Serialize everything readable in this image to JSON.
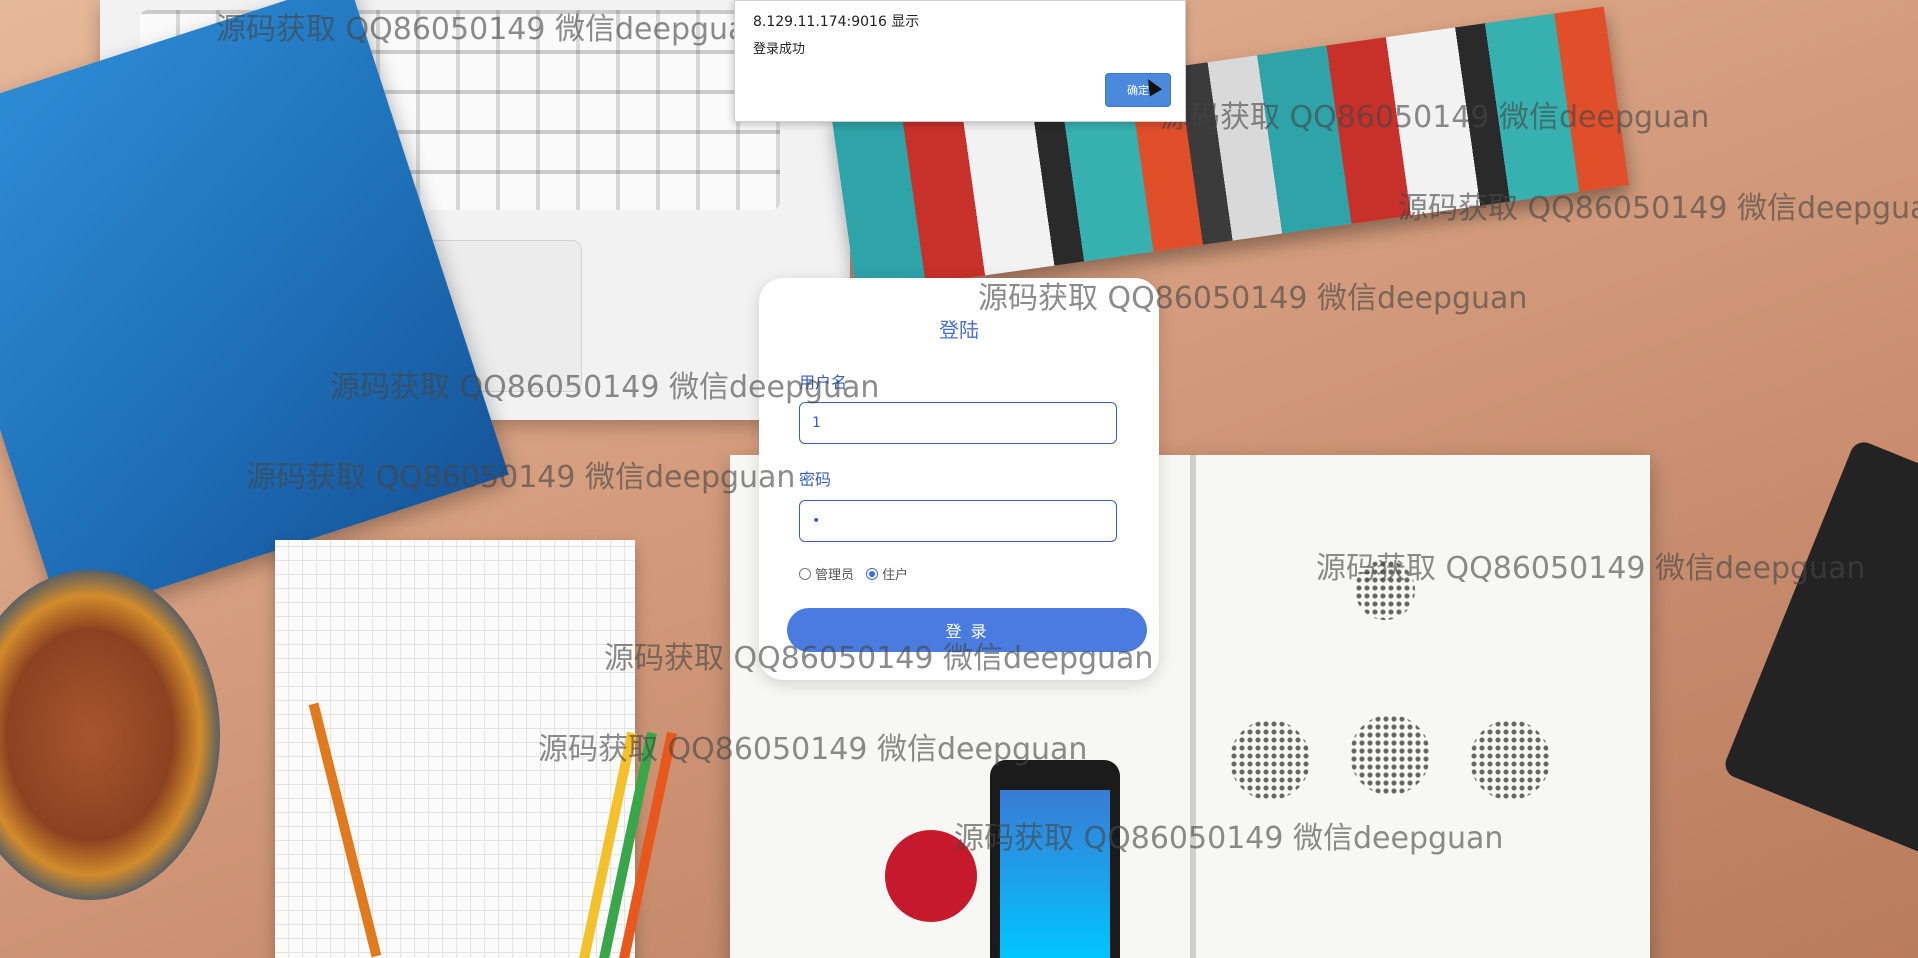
{
  "alert": {
    "origin": "8.129.11.174:9016 显示",
    "message": "登录成功",
    "ok_label": "确定"
  },
  "login": {
    "title": "登陆",
    "username_label": "用户名",
    "username_value": "1",
    "password_label": "密码",
    "password_value": "•",
    "roles": [
      {
        "label": "管理员",
        "selected": false
      },
      {
        "label": "住户",
        "selected": true
      }
    ],
    "submit_label": "登 录"
  },
  "watermark": "源码获取 QQ86050149 微信deepguan",
  "colors": {
    "accent": "#4a7ce0",
    "label": "#3a5fc0"
  }
}
